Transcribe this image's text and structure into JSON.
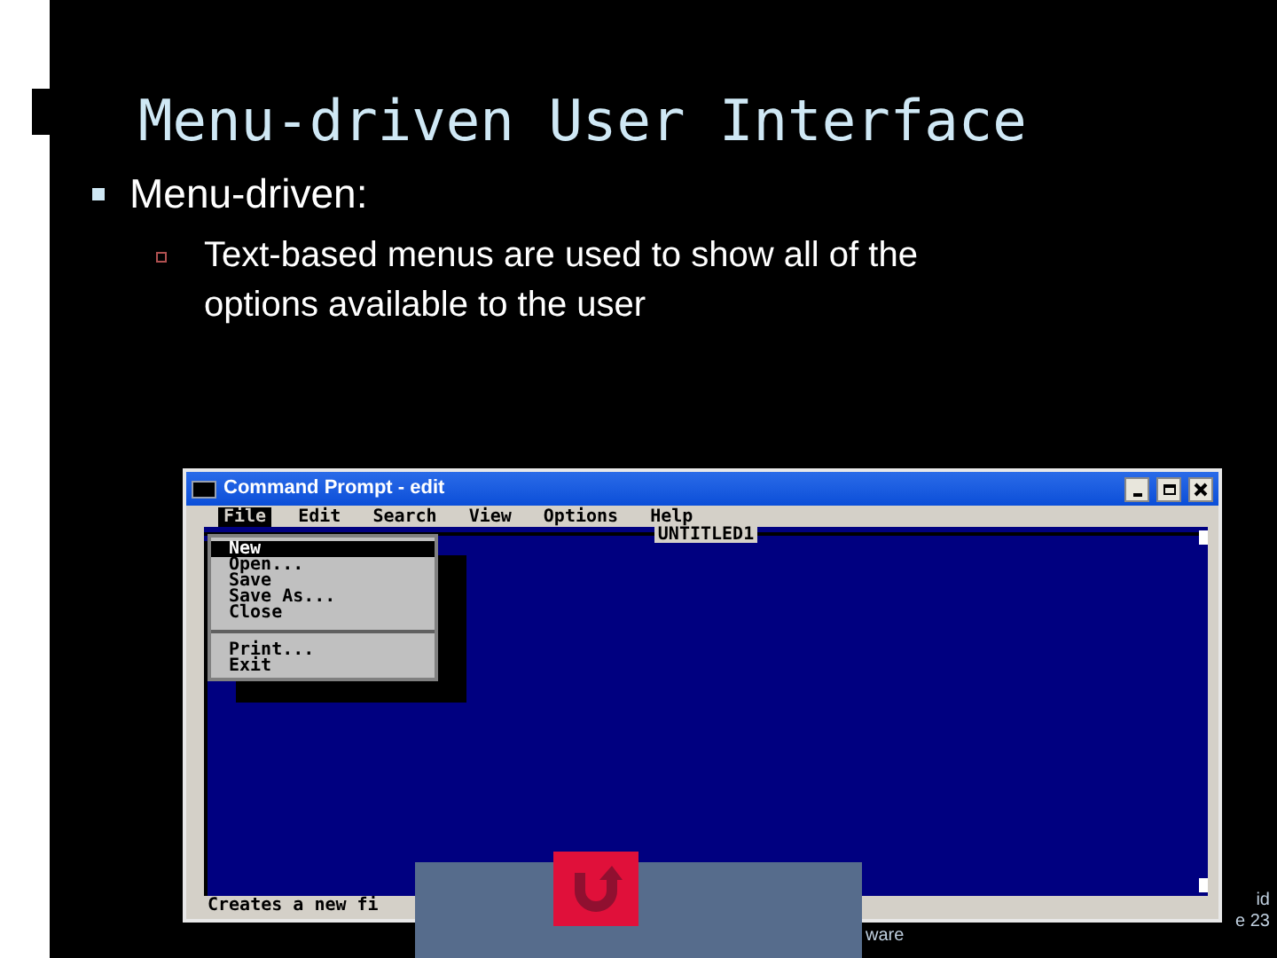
{
  "slide": {
    "title": "Menu-driven User Interface",
    "bullets": [
      {
        "text": "Menu-driven:",
        "children": [
          {
            "text": "Text-based menus are used to show all of the options available to the user"
          }
        ]
      }
    ]
  },
  "window": {
    "title": "Command Prompt - edit",
    "menubar": [
      {
        "label": "File",
        "selected": true
      },
      {
        "label": "Edit",
        "selected": false
      },
      {
        "label": "Search",
        "selected": false
      },
      {
        "label": "View",
        "selected": false
      },
      {
        "label": "Options",
        "selected": false
      },
      {
        "label": "Help",
        "selected": false
      }
    ],
    "document_title": "UNTITLED1",
    "file_menu": [
      {
        "kind": "item",
        "label": "New",
        "selected": true
      },
      {
        "kind": "item",
        "label": "Open...",
        "selected": false
      },
      {
        "kind": "item",
        "label": "Save",
        "selected": false
      },
      {
        "kind": "item",
        "label": "Save As...",
        "selected": false
      },
      {
        "kind": "item",
        "label": "Close",
        "selected": false
      },
      {
        "kind": "separator"
      },
      {
        "kind": "item",
        "label": "Print...",
        "selected": false
      },
      {
        "kind": "item",
        "label": "Exit",
        "selected": false
      }
    ],
    "status_bar": "Creates a new fi"
  },
  "footer": {
    "left": "ware",
    "right_top": "id",
    "right_bottom": "e 23"
  }
}
